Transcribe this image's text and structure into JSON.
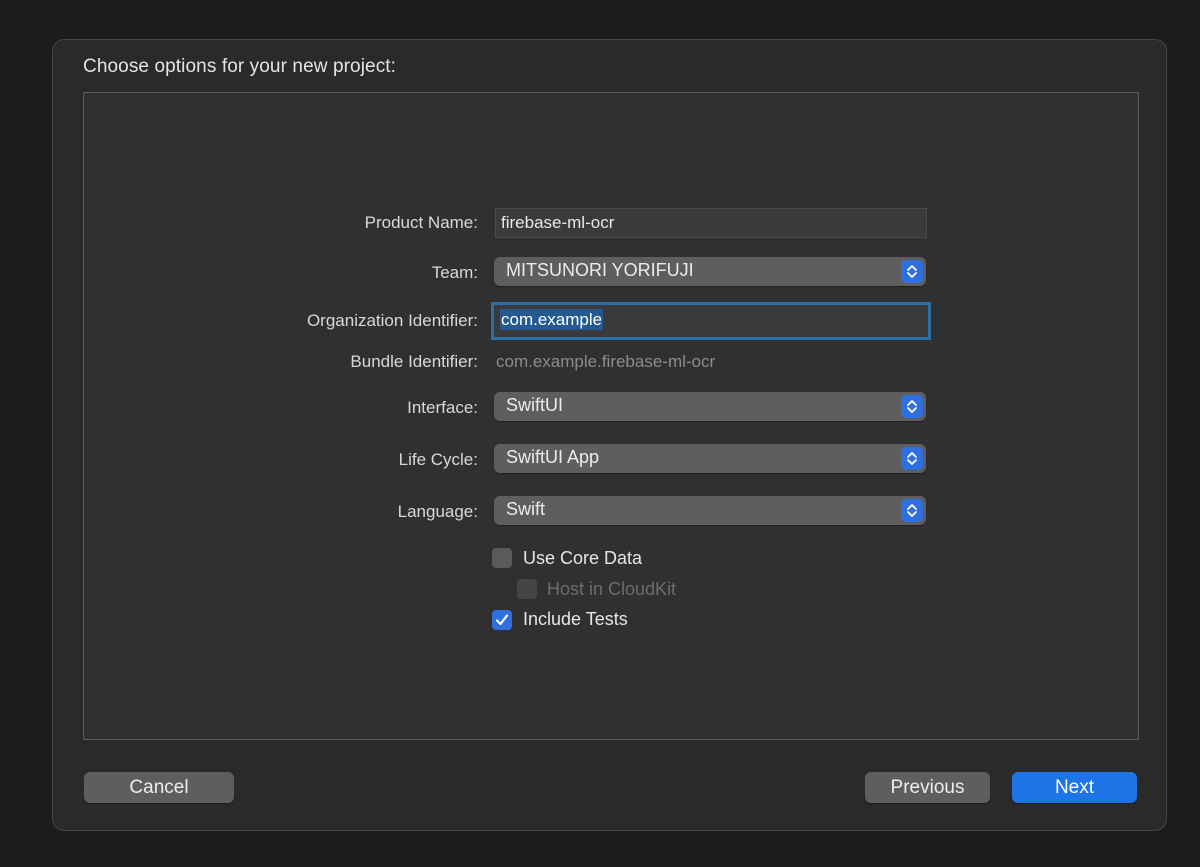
{
  "sheet": {
    "title": "Choose options for your new project:"
  },
  "form": {
    "product_name": {
      "label": "Product Name:",
      "value": "firebase-ml-ocr"
    },
    "team": {
      "label": "Team:",
      "value": "MITSUNORI YORIFUJI"
    },
    "organization_identifier": {
      "label": "Organization Identifier:",
      "value": "com.example"
    },
    "bundle_identifier": {
      "label": "Bundle Identifier:",
      "value": "com.example.firebase-ml-ocr"
    },
    "interface": {
      "label": "Interface:",
      "value": "SwiftUI"
    },
    "life_cycle": {
      "label": "Life Cycle:",
      "value": "SwiftUI App"
    },
    "language": {
      "label": "Language:",
      "value": "Swift"
    }
  },
  "checkboxes": {
    "use_core_data": {
      "label": "Use Core Data",
      "checked": false,
      "enabled": true
    },
    "host_in_cloudkit": {
      "label": "Host in CloudKit",
      "checked": false,
      "enabled": false
    },
    "include_tests": {
      "label": "Include Tests",
      "checked": true,
      "enabled": true
    }
  },
  "buttons": {
    "cancel": "Cancel",
    "previous": "Previous",
    "next": "Next"
  },
  "colors": {
    "accent": "#1d74e6",
    "focus_ring": "#2a6fa8",
    "selection": "#245a8f"
  },
  "icons": {
    "popup_indicator": "chevron-up-down-icon",
    "checkmark": "checkmark-icon"
  }
}
